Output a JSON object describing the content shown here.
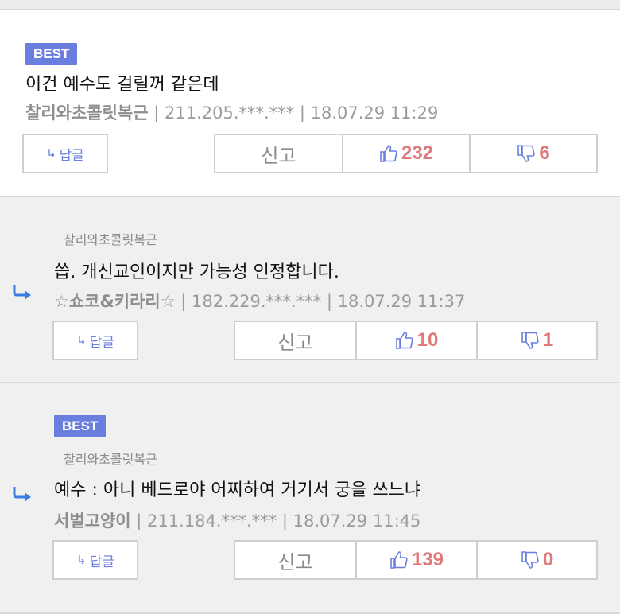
{
  "comments": [
    {
      "badge": "BEST",
      "parent": "",
      "text": "이건 예수도 걸릴꺼 같은데",
      "author": "찰리와초콜릿복근",
      "meta_rest": " | 211.205.***.*** | 18.07.29 11:29",
      "reply_label": "답글",
      "report_label": "신고",
      "likes": "232",
      "dislikes": "6"
    },
    {
      "badge": "",
      "parent": "찰리와초콜릿복근",
      "text": "씁. 개신교인이지만 가능성 인정합니다.",
      "author": "☆쇼코&키라리☆",
      "meta_rest": " | 182.229.***.*** | 18.07.29 11:37",
      "reply_label": "답글",
      "report_label": "신고",
      "likes": "10",
      "dislikes": "1"
    },
    {
      "badge": "BEST",
      "parent": "찰리와초콜릿복근",
      "text": "예수 : 아니 베드로야 어찌하여 거기서 궁을 쓰느냐",
      "author": "서벌고양이",
      "meta_rest": " | 211.184.***.*** | 18.07.29 11:45",
      "reply_label": "답글",
      "report_label": "신고",
      "likes": "139",
      "dislikes": "0"
    }
  ],
  "colors": {
    "accent": "#6a7ee0",
    "count": "#e07a7a",
    "reply_arrow": "#3a7de0"
  },
  "icons": [
    "reply-arrow-icon",
    "thumbs-up-icon",
    "thumbs-down-icon"
  ]
}
